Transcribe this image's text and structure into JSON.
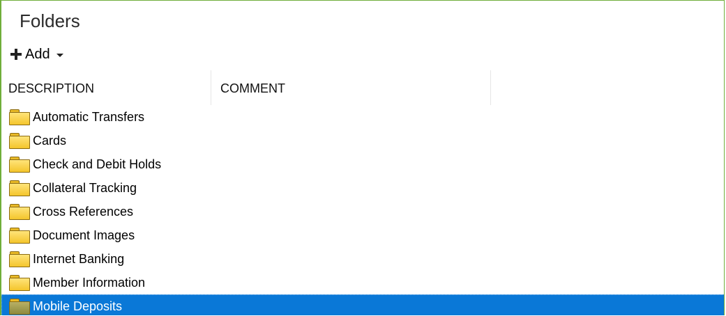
{
  "panel": {
    "title": "Folders",
    "border_color": "#6fae3a"
  },
  "toolbar": {
    "add_label": "Add",
    "add_icon": "plus-icon",
    "dropdown_icon": "caret-down-icon"
  },
  "grid": {
    "columns": [
      "DESCRIPTION",
      "COMMENT"
    ],
    "rows": [
      {
        "description": "Automatic Transfers",
        "comment": "",
        "selected": false
      },
      {
        "description": "Cards",
        "comment": "",
        "selected": false
      },
      {
        "description": "Check and Debit Holds",
        "comment": "",
        "selected": false
      },
      {
        "description": "Collateral Tracking",
        "comment": "",
        "selected": false
      },
      {
        "description": "Cross References",
        "comment": "",
        "selected": false
      },
      {
        "description": "Document Images",
        "comment": "",
        "selected": false
      },
      {
        "description": "Internet Banking",
        "comment": "",
        "selected": false
      },
      {
        "description": "Member Information",
        "comment": "",
        "selected": false
      },
      {
        "description": "Mobile Deposits",
        "comment": "",
        "selected": true
      }
    ],
    "row_icon": "folder-icon",
    "selection_color": "#0a78d7"
  }
}
